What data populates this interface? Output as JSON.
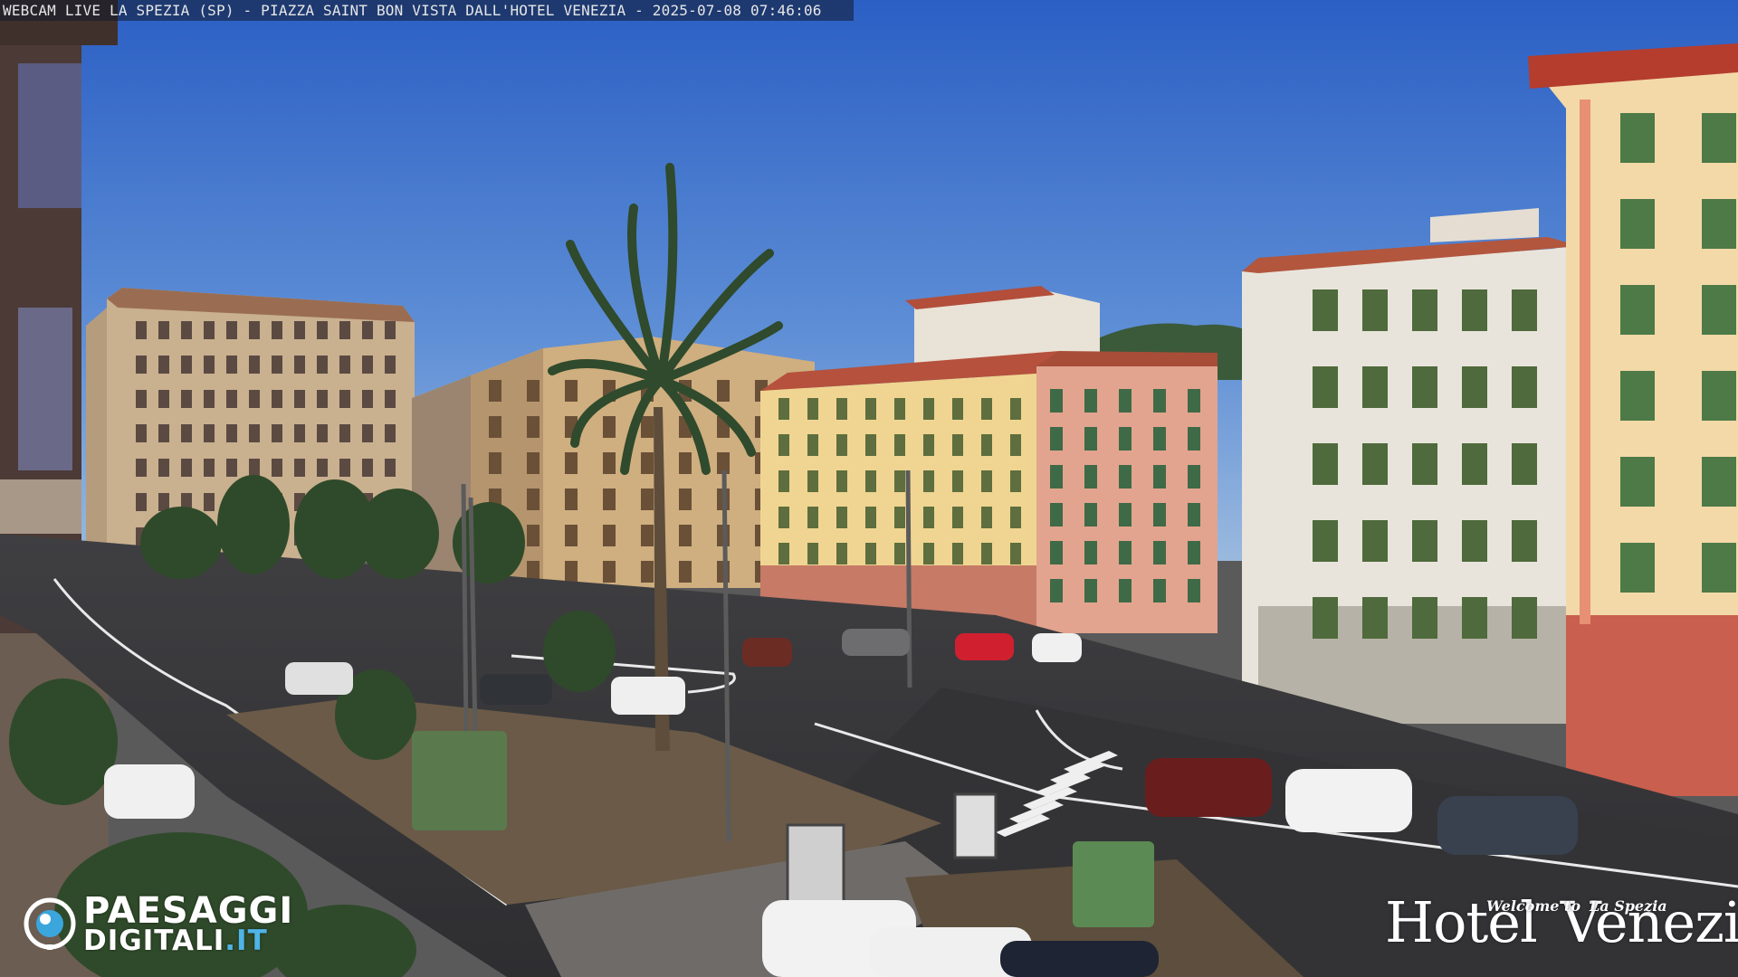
{
  "overlay": {
    "caption": "WEBCAM LIVE LA SPEZIA (SP) - PIAZZA SAINT BON VISTA DALL'HOTEL VENEZIA - 2025-07-08 07:46:06"
  },
  "logos": {
    "paesaggi": {
      "top": "PAESAGGI",
      "bottom": "DIGITALI",
      "tld": ".IT"
    },
    "hotel": {
      "welcome": "Welcome",
      "to": "to",
      "city": "La Spezia",
      "word1": "Hotel",
      "word2": "Venezia"
    }
  },
  "colors": {
    "sky_top": "#2b5fc4",
    "sky_bottom": "#8fb3dc",
    "accent_logo": "#4fb4e6"
  }
}
